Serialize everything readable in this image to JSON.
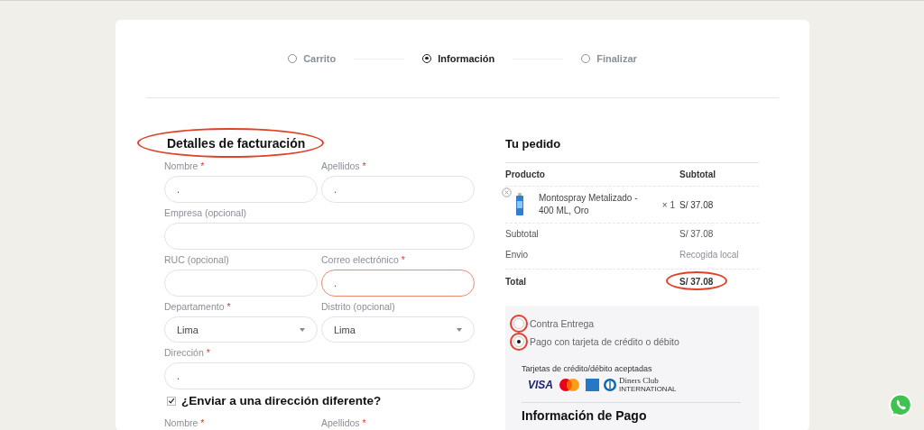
{
  "steps": [
    {
      "label": "Carrito",
      "selected": false
    },
    {
      "label": "Información",
      "selected": true
    },
    {
      "label": "Finalizar",
      "selected": false
    }
  ],
  "required_mark": "*",
  "billing": {
    "title": "Detalles de facturación",
    "annotated": true,
    "rows": [
      [
        {
          "label": "Nombre",
          "required": true,
          "kind": "input",
          "value": ".",
          "invalid": false
        },
        {
          "label": "Apellidos",
          "required": true,
          "kind": "input",
          "value": ".",
          "invalid": false
        }
      ],
      [
        {
          "label": "Empresa (opcional)",
          "required": false,
          "kind": "input",
          "invalid": false
        }
      ],
      [
        {
          "label": "RUC (opcional)",
          "required": false,
          "kind": "input",
          "invalid": false
        },
        {
          "label": "Correo electrónico",
          "required": true,
          "kind": "input",
          "value": ".",
          "invalid": true
        }
      ],
      [
        {
          "label": "Departamento",
          "required": true,
          "kind": "select",
          "value": "Lima",
          "invalid": false
        },
        {
          "label": "Distrito  (opcional)",
          "required": false,
          "kind": "select",
          "value": "Lima",
          "invalid": false
        }
      ],
      [
        {
          "label": "Dirección",
          "required": true,
          "kind": "input",
          "value": ".",
          "invalid": false
        }
      ]
    ]
  },
  "ship_different": {
    "label": "¿Enviar a una dirección diferente?",
    "checked": true
  },
  "shipping_labels": [
    {
      "label": "Nombre",
      "required": true
    },
    {
      "label": "Apellidos",
      "required": true
    }
  ],
  "order": {
    "title": "Tu pedido",
    "columns": [
      "Producto",
      "Subtotal"
    ],
    "item": {
      "name": "Montospray Metalizado - 400 ML, Oro",
      "qty": "× 1",
      "price": "S/ 37.08"
    },
    "totals": [
      {
        "label": "Subtotal",
        "value": "S/ 37.08",
        "kind": "plain",
        "annotated": false
      },
      {
        "label": "Envio",
        "value": "Recogida local",
        "kind": "muted",
        "annotated": false
      },
      {
        "label": "Total",
        "value": "S/ 37.08",
        "kind": "total",
        "annotated": true
      }
    ]
  },
  "payment": {
    "methods": [
      {
        "label": "Contra Entrega",
        "selected": false,
        "annotated": true
      },
      {
        "label": "Pago con tarjeta de crédito o débito",
        "selected": true,
        "annotated": true
      }
    ],
    "cards_title": "Tarjetas de crédito/débito aceptadas",
    "logos": [
      {
        "kind": "visa",
        "label": "VISA"
      },
      {
        "kind": "mastercard"
      },
      {
        "kind": "amex"
      },
      {
        "kind": "diners",
        "label": "Diners Club",
        "sublabel": "INTERNATIONAL"
      }
    ],
    "info_title": "Información de Pago"
  }
}
